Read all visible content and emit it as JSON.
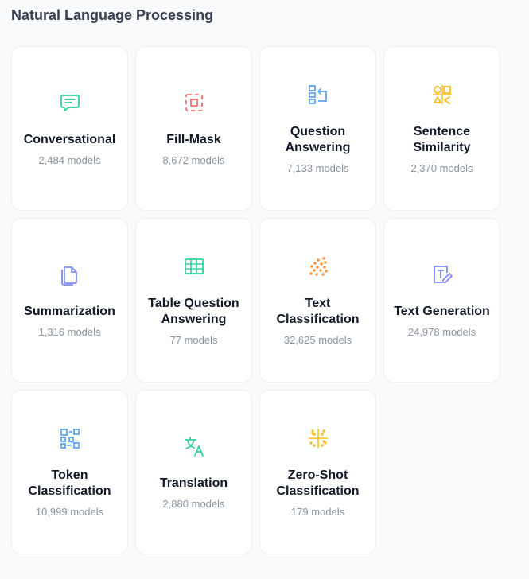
{
  "section": {
    "title": "Natural Language Processing"
  },
  "tasks": [
    {
      "name": "Conversational",
      "count": "2,484 models",
      "icon": "chat-icon",
      "color": "#34d399"
    },
    {
      "name": "Fill-Mask",
      "count": "8,672 models",
      "icon": "fill-mask-icon",
      "color": "#f87171"
    },
    {
      "name": "Question Answering",
      "count": "7,133 models",
      "icon": "question-answering-icon",
      "color": "#60a5fa"
    },
    {
      "name": "Sentence Similarity",
      "count": "2,370 models",
      "icon": "sentence-similarity-icon",
      "color": "#fbbf24"
    },
    {
      "name": "Summarization",
      "count": "1,316 models",
      "icon": "documents-icon",
      "color": "#818cf8"
    },
    {
      "name": "Table Question Answering",
      "count": "77 models",
      "icon": "table-icon",
      "color": "#34d399"
    },
    {
      "name": "Text Classification",
      "count": "32,625 models",
      "icon": "dots-icon",
      "color": "#fb923c"
    },
    {
      "name": "Text Generation",
      "count": "24,978 models",
      "icon": "text-pencil-icon",
      "color": "#818cf8"
    },
    {
      "name": "Token Classification",
      "count": "10,999 models",
      "icon": "token-grid-icon",
      "color": "#60a5fa"
    },
    {
      "name": "Translation",
      "count": "2,880 models",
      "icon": "translate-icon",
      "color": "#34d399"
    },
    {
      "name": "Zero-Shot Classification",
      "count": "179 models",
      "icon": "scatter-crosshair-icon",
      "color": "#fbbf24"
    }
  ]
}
